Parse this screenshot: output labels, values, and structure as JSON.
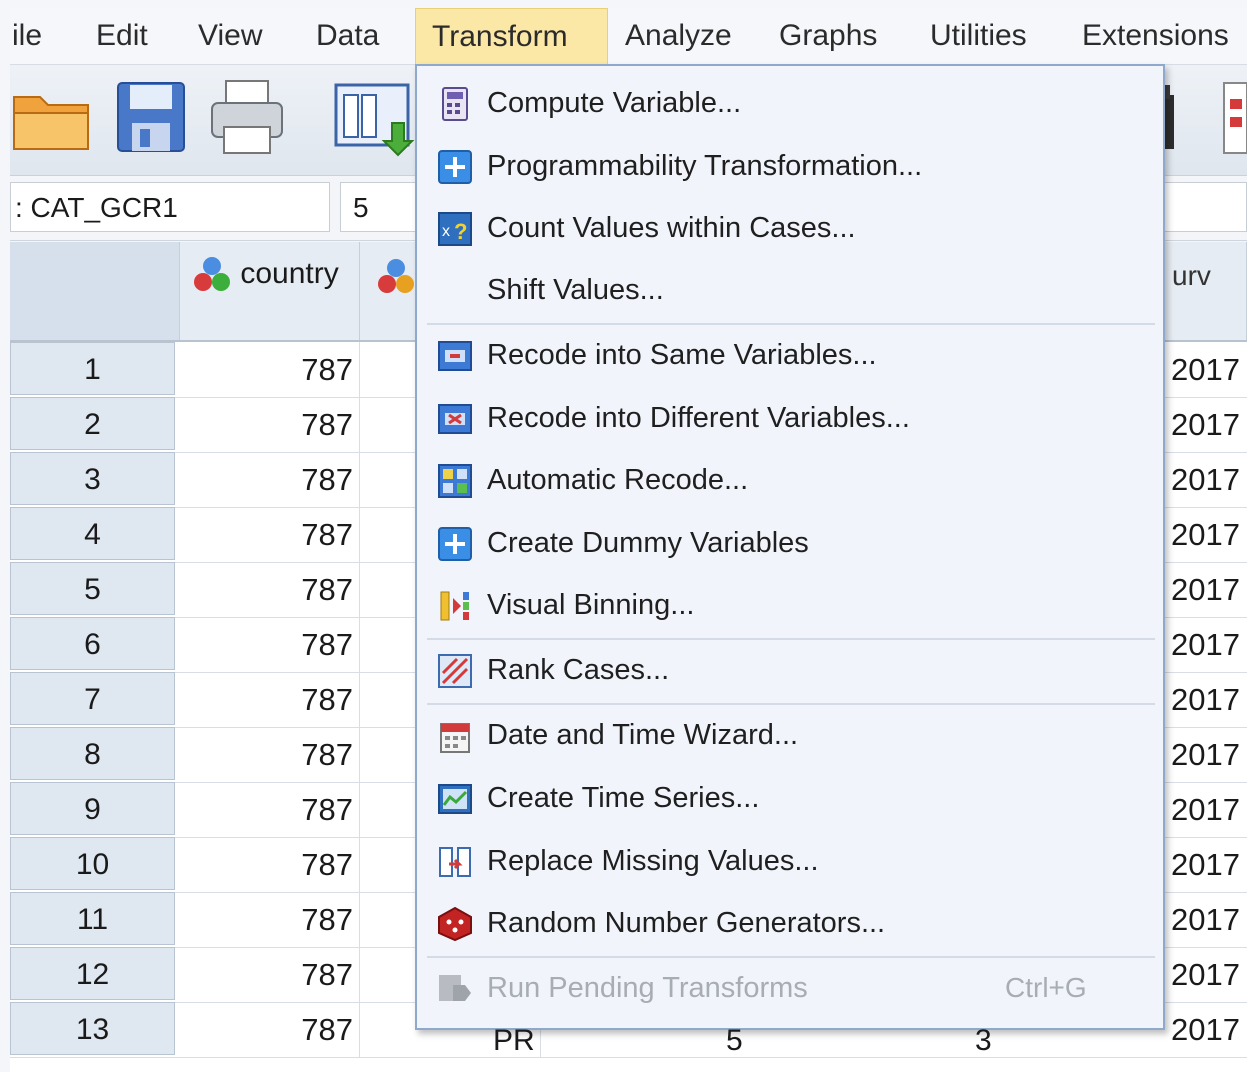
{
  "menubar": {
    "items": [
      "ile",
      "Edit",
      "View",
      "Data",
      "Transform",
      "Analyze",
      "Graphs",
      "Utilities",
      "Extensions"
    ],
    "active": "Transform"
  },
  "cell_editor": {
    "name": ": CAT_GCR1",
    "value": "5"
  },
  "grid": {
    "columns": {
      "country": "country",
      "right_partial": "urv"
    },
    "rows": [
      {
        "num": "1",
        "country": "787",
        "year": "2017"
      },
      {
        "num": "2",
        "country": "787",
        "year": "2017"
      },
      {
        "num": "3",
        "country": "787",
        "year": "2017"
      },
      {
        "num": "4",
        "country": "787",
        "year": "2017"
      },
      {
        "num": "5",
        "country": "787",
        "year": "2017"
      },
      {
        "num": "6",
        "country": "787",
        "year": "2017"
      },
      {
        "num": "7",
        "country": "787",
        "year": "2017"
      },
      {
        "num": "8",
        "country": "787",
        "year": "2017"
      },
      {
        "num": "9",
        "country": "787",
        "year": "2017"
      },
      {
        "num": "10",
        "country": "787",
        "year": "2017"
      },
      {
        "num": "11",
        "country": "787",
        "year": "2017"
      },
      {
        "num": "12",
        "country": "787",
        "year": "2017"
      },
      {
        "num": "13",
        "country": "787",
        "year": "2017"
      }
    ],
    "row13_partial": {
      "col3": "PR",
      "col4": "5",
      "col5": "3"
    }
  },
  "transform_menu": {
    "items": [
      {
        "label": "Compute Variable...",
        "icon": "calculator-icon"
      },
      {
        "label": "Programmability Transformation...",
        "icon": "plus-icon"
      },
      {
        "label": "Count Values within Cases...",
        "icon": "count-values-icon"
      },
      {
        "label": "Shift Values...",
        "icon": ""
      },
      {
        "label": "Recode into Same Variables...",
        "icon": "recode-same-icon"
      },
      {
        "label": "Recode into Different Variables...",
        "icon": "recode-different-icon"
      },
      {
        "label": "Automatic Recode...",
        "icon": "automatic-recode-icon"
      },
      {
        "label": "Create Dummy Variables",
        "icon": "plus-icon"
      },
      {
        "label": "Visual Binning...",
        "icon": "visual-binning-icon"
      },
      {
        "label": "Rank Cases...",
        "icon": "rank-cases-icon"
      },
      {
        "label": "Date and Time Wizard...",
        "icon": "calendar-icon"
      },
      {
        "label": "Create Time Series...",
        "icon": "time-series-icon"
      },
      {
        "label": "Replace Missing Values...",
        "icon": "replace-missing-icon"
      },
      {
        "label": "Random Number Generators...",
        "icon": "dice-icon"
      },
      {
        "label": "Run Pending Transforms",
        "icon": "run-pending-icon",
        "shortcut": "Ctrl+G",
        "disabled": true
      }
    ]
  },
  "colors": {
    "menu_bg": "#f1f5fb",
    "active_menu": "#fbe7a6",
    "disabled_text": "#a8adb3",
    "row_header": "#dfe7f1"
  }
}
